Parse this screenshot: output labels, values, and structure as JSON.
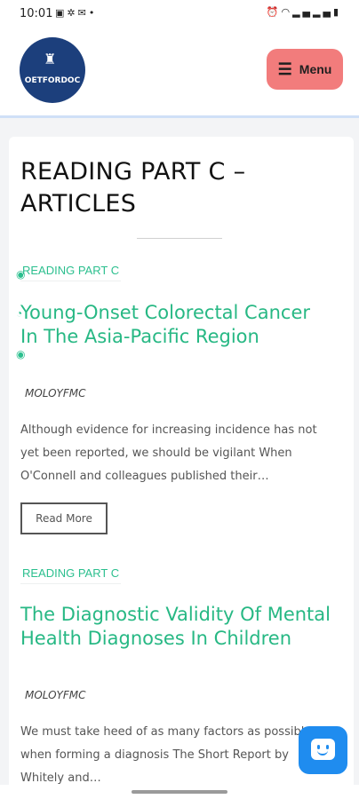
{
  "status_bar": {
    "time": "10:01",
    "left_icons": [
      "image-icon",
      "settings-icon",
      "mail-icon",
      "dot-icon"
    ],
    "right_icons": [
      "alarm-icon",
      "wifi-icon",
      "signal-icon",
      "signal-icon",
      "battery-icon"
    ]
  },
  "header": {
    "logo_text": "OETFORDOC",
    "menu_label": "Menu",
    "colors": {
      "logo_bg": "#1c3f7c",
      "menu_bg": "#f27c7c"
    }
  },
  "page": {
    "title": "READING PART C – ARTICLES"
  },
  "articles": [
    {
      "category": "READING PART C",
      "title": "Young-Onset Colorectal Cancer In The Asia-Pacific Region",
      "author": "MOLOYFMC",
      "excerpt": "Although evidence for increasing incidence has not yet been reported, we should be vigilant When O'Connell and colleagues published their…",
      "button": "Read More"
    },
    {
      "category": "READING PART C",
      "title": "The Diagnostic Validity Of Mental Health Diagnoses In Children",
      "author": "MOLOYFMC",
      "excerpt": "We must take heed of as many factors as possible when forming a diagnosis The Short Report by Whitely and…"
    }
  ],
  "accent_color": "#27b884",
  "chat": {
    "icon": "chat-smile-icon",
    "color": "#1f8cef"
  }
}
